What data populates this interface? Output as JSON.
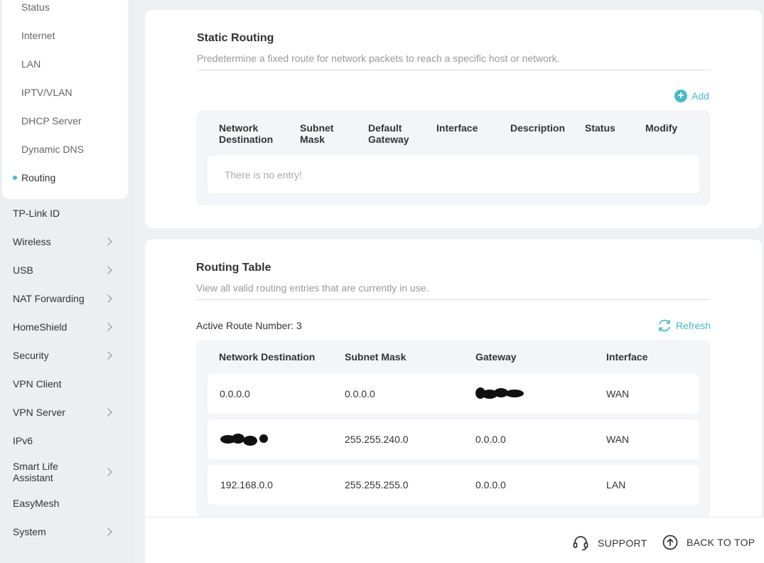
{
  "sidebar": {
    "sub_items": [
      "Status",
      "Internet",
      "LAN",
      "IPTV/VLAN",
      "DHCP Server",
      "Dynamic DNS",
      "Routing"
    ],
    "active_sub_item": "Routing",
    "nav_items": [
      {
        "label": "TP-Link ID",
        "chevron": false
      },
      {
        "label": "Wireless",
        "chevron": true
      },
      {
        "label": "USB",
        "chevron": true
      },
      {
        "label": "NAT Forwarding",
        "chevron": true
      },
      {
        "label": "HomeShield",
        "chevron": true
      },
      {
        "label": "Security",
        "chevron": true
      },
      {
        "label": "VPN Client",
        "chevron": false
      },
      {
        "label": "VPN Server",
        "chevron": true
      },
      {
        "label": "IPv6",
        "chevron": false
      },
      {
        "label": "Smart Life\nAssistant",
        "chevron": true
      },
      {
        "label": "EasyMesh",
        "chevron": false
      },
      {
        "label": "System",
        "chevron": true
      }
    ]
  },
  "static_routing": {
    "title": "Static Routing",
    "description": "Predetermine a fixed route for network packets to reach a specific host or network.",
    "add_label": "Add",
    "columns": [
      "Network\nDestination",
      "Subnet\nMask",
      "Default\nGateway",
      "Interface",
      "Description",
      "Status",
      "Modify"
    ],
    "empty_text": "There is no entry!"
  },
  "routing_table": {
    "title": "Routing Table",
    "description": "View all valid routing entries that are currently in use.",
    "active_route_label": "Active Route Number: 3",
    "refresh_label": "Refresh",
    "columns": [
      "Network Destination",
      "Subnet Mask",
      "Gateway",
      "Interface"
    ],
    "rows": [
      {
        "destination": "0.0.0.0",
        "mask": "0.0.0.0",
        "gateway": "",
        "interface": "WAN"
      },
      {
        "destination": "",
        "mask": "255.255.240.0",
        "gateway": "0.0.0.0",
        "interface": "WAN"
      },
      {
        "destination": "192.168.0.0",
        "mask": "255.255.255.0",
        "gateway": "0.0.0.0",
        "interface": "LAN"
      }
    ]
  },
  "footer": {
    "support_label": "SUPPORT",
    "back_to_top_label": "BACK TO TOP"
  },
  "colors": {
    "accent": "#4ab9c9",
    "background": "#eef0f3",
    "card": "#ffffff"
  }
}
